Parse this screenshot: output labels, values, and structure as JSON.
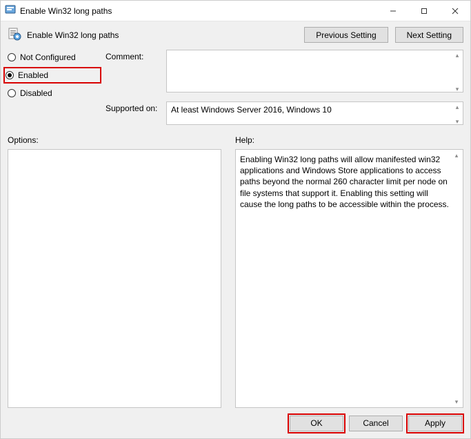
{
  "window": {
    "title": "Enable Win32 long paths"
  },
  "header": {
    "title": "Enable Win32 long paths",
    "prev": "Previous Setting",
    "next": "Next Setting"
  },
  "radios": {
    "not_configured": "Not Configured",
    "enabled": "Enabled",
    "disabled": "Disabled"
  },
  "fields": {
    "comment_label": "Comment:",
    "comment_value": "",
    "supported_label": "Supported on:",
    "supported_value": "At least Windows Server 2016, Windows 10"
  },
  "lower": {
    "options_label": "Options:",
    "help_label": "Help:",
    "help_text": "Enabling Win32 long paths will allow manifested win32 applications and Windows Store applications to access paths beyond the normal 260 character limit per node on file systems that support it.  Enabling this setting will cause the long paths to be accessible within the process."
  },
  "footer": {
    "ok": "OK",
    "cancel": "Cancel",
    "apply": "Apply"
  }
}
